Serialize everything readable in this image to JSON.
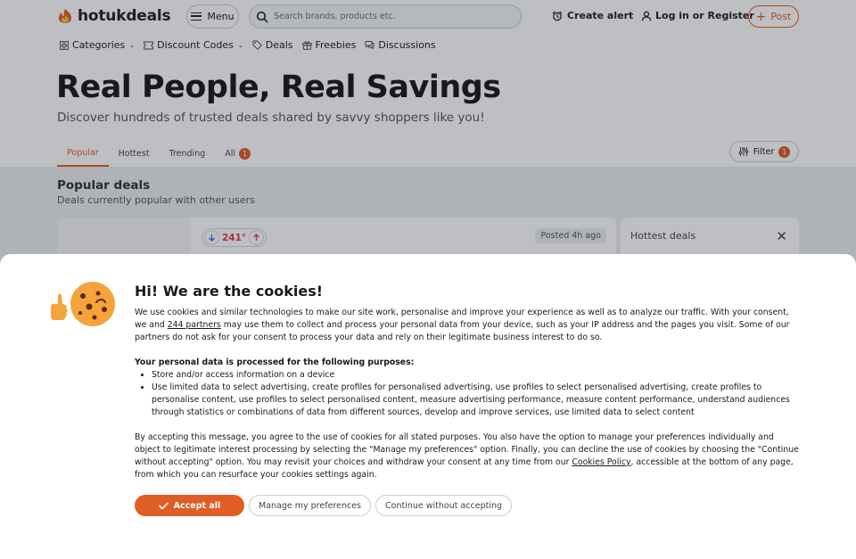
{
  "brand": {
    "name": "hotukdeals",
    "accent": "#e05d25"
  },
  "header": {
    "menu_label": "Menu",
    "search_placeholder": "Search brands, products etc.",
    "create_alert": "Create alert",
    "login": "Log in or Register",
    "post": "Post"
  },
  "nav": {
    "items": [
      {
        "label": "Categories",
        "icon": "grid-icon",
        "dropdown": true
      },
      {
        "label": "Discount Codes",
        "icon": "ticket-icon",
        "dropdown": true
      },
      {
        "label": "Deals",
        "icon": "tag-icon",
        "dropdown": false
      },
      {
        "label": "Freebies",
        "icon": "gift-icon",
        "dropdown": false
      },
      {
        "label": "Discussions",
        "icon": "chat-icon",
        "dropdown": false
      }
    ]
  },
  "hero": {
    "title": "Real People, Real Savings",
    "subtitle": "Discover hundreds of trusted deals shared by savvy shoppers like you!"
  },
  "tabs": {
    "items": [
      "Popular",
      "Hottest",
      "Trending",
      "All"
    ],
    "active": "Popular",
    "all_badge": "1",
    "filter_label": "Filter",
    "filter_badge": "1"
  },
  "section": {
    "title": "Popular deals",
    "subtitle": "Deals currently popular with other users"
  },
  "deal": {
    "temperature": "241°",
    "posted": "Posted 4h ago"
  },
  "sidebar": {
    "hottest_title": "Hottest deals"
  },
  "cookie": {
    "title": "Hi! We are the cookies!",
    "intro_1": "We use cookies and similar technologies to make our site work, personalise and improve your experience as well as to analyze our traffic. With your consent, we and ",
    "partners_link": "244 partners",
    "intro_2": " may use them to collect and process your personal data from your device, such as your IP address and the pages you visit. Some of our partners do not ask for your consent to process your data and rely on their legitimate business interest to do so.",
    "purposes_heading": "Your personal data is processed for the following purposes:",
    "purposes": [
      "Store and/or access information on a device",
      "Use limited data to select advertising, create profiles for personalised advertising, use profiles to select personalised advertising, create profiles to personalise content, use profiles to select personalised content, measure advertising performance, measure content performance, understand audiences through statistics or combinations of data from different sources, develop and improve services, use limited data to select content"
    ],
    "accept_text_1": "By accepting this message, you agree to the use of cookies for all stated purposes. You also have the option to manage your preferences individually and object to legitimate interest processing by selecting the \"Manage my preferences\" option. Finally, you can decline the use of cookies by choosing the \"Continue without accepting\" option. You may revisit your choices and withdraw your consent at any time from our ",
    "policy_link": "Cookies Policy",
    "accept_text_2": ", accessible at the bottom of any page, from which you can resurface your cookies settings again.",
    "buttons": {
      "accept": "Accept all",
      "manage": "Manage my preferences",
      "continue": "Continue without accepting"
    }
  }
}
